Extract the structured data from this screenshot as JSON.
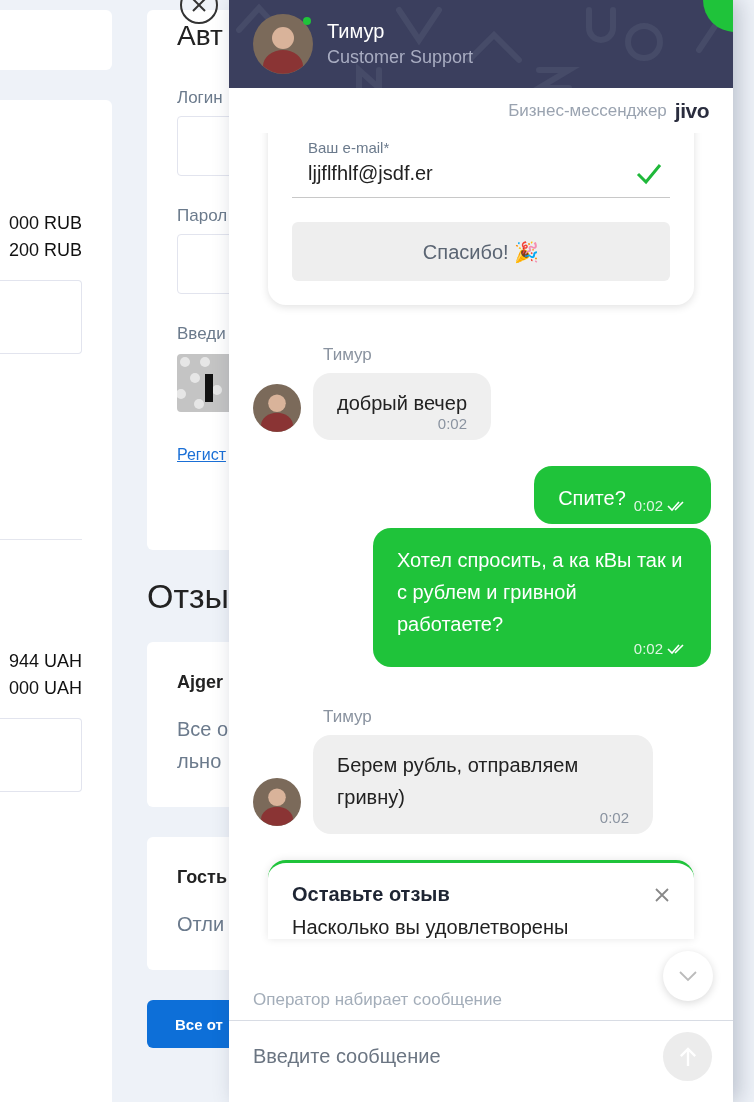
{
  "background_page": {
    "left_column": {
      "amounts_rub": [
        "000 RUB",
        "200 RUB"
      ],
      "amounts_uah": [
        "944 UAH",
        "000 UAH"
      ]
    },
    "login_card": {
      "title": "Авт",
      "fields": [
        {
          "label": "Логин"
        },
        {
          "label": "Парол"
        }
      ],
      "captcha_label": "Введи",
      "register_link": "Регист"
    },
    "reviews": {
      "title": "Отзы",
      "items": [
        {
          "author": "Ajger",
          "text_lines": [
            "Все о",
            "льно"
          ]
        },
        {
          "author": "Гость",
          "text_lines": [
            "Отли"
          ]
        }
      ],
      "all_button": "Все от"
    }
  },
  "chat": {
    "operator": {
      "name": "Тимур",
      "role": "Customer Support",
      "online": true
    },
    "branding": {
      "label": "Бизнес-мессенджер",
      "logo": "jivo"
    },
    "email_form": {
      "label": "Ваш e-mail*",
      "value": "ljjflfhlf@jsdf.er",
      "valid": true,
      "button": "Спасибо! 🎉"
    },
    "messages": [
      {
        "kind": "agent",
        "author": "Тимур",
        "text": "добрый вечер",
        "time": "0:02"
      },
      {
        "kind": "client",
        "text": "Спите?",
        "time": "0:02",
        "read": true
      },
      {
        "kind": "client",
        "text": "Хотел спросить, а ка кВы так и с рублем и гривной работаете?",
        "time": "0:02",
        "read": true
      },
      {
        "kind": "agent",
        "author": "Тимур",
        "text": "Берем рубль, отправляем гривну)",
        "time": "0:02"
      }
    ],
    "review_prompt": {
      "title": "Оставьте отзыв",
      "question": "Насколько вы удовлетворены"
    },
    "typing_status": "Оператор набирает сообщение",
    "composer": {
      "placeholder": "Введите сообщение"
    }
  }
}
